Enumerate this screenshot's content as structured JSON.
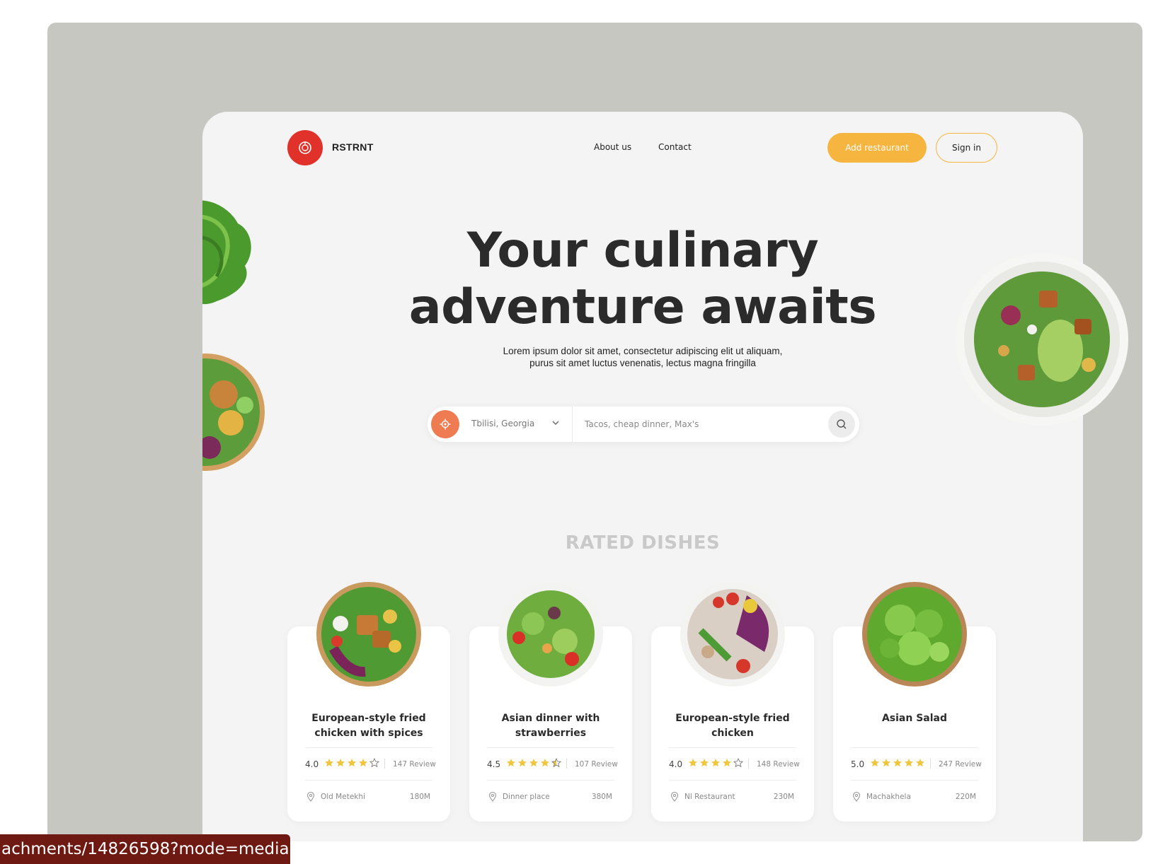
{
  "header": {
    "brand": "RSTRNT",
    "nav": [
      "About us",
      "Contact"
    ],
    "add_label": "Add restaurant",
    "signin_label": "Sign in"
  },
  "hero": {
    "title_line1": "Your culinary",
    "title_line2": "adventure awaits",
    "subtitle": "Lorem ipsum dolor sit amet, consectetur adipiscing elit ut aliquam, purus sit amet luctus venenatis, lectus magna fringilla"
  },
  "search": {
    "location": "Tbilisi, Georgia",
    "placeholder": "Tacos, cheap dinner, Max's"
  },
  "section_title": "RATED DISHES",
  "dishes": [
    {
      "title": "European-style fried chicken with spices",
      "rating": "4.0",
      "stars": 4,
      "reviews": "147 Review",
      "place": "Old Metekhi",
      "distance": "180M"
    },
    {
      "title": "Asian dinner with strawberries",
      "rating": "4.5",
      "stars": 4.5,
      "reviews": "107 Review",
      "place": "Dinner place",
      "distance": "380M"
    },
    {
      "title": "European-style fried chicken",
      "rating": "4.0",
      "stars": 4,
      "reviews": "148 Review",
      "place": "Nl Restaurant",
      "distance": "230M"
    },
    {
      "title": "Asian Salad",
      "rating": "5.0",
      "stars": 5,
      "reviews": "247 Review",
      "place": "Machakhela",
      "distance": "220M"
    }
  ],
  "colors": {
    "accent_yellow": "#f5b53f",
    "brand_red": "#e0322b",
    "location_orange": "#ef7b52",
    "star": "#f0c63c"
  },
  "status_url": "achments/14826598?mode=media"
}
